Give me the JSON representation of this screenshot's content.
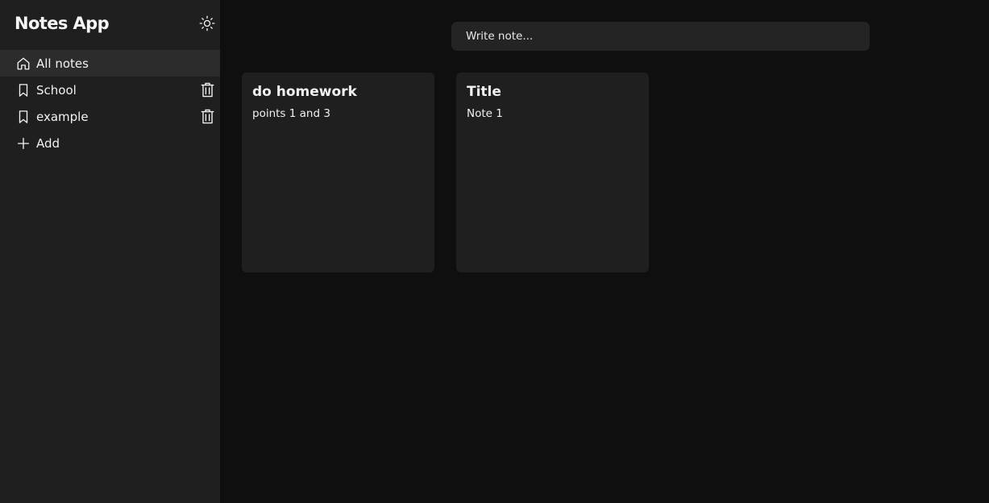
{
  "sidebar": {
    "title": "Notes App",
    "theme_toggle_icon": "sun-icon",
    "items": [
      {
        "label": "All notes",
        "icon": "home-icon",
        "active": true,
        "deletable": false
      },
      {
        "label": "School",
        "icon": "bookmark-icon",
        "active": false,
        "deletable": true
      },
      {
        "label": "example",
        "icon": "bookmark-icon",
        "active": false,
        "deletable": true
      }
    ],
    "add": {
      "label": "Add",
      "icon": "plus-icon"
    }
  },
  "main": {
    "search": {
      "placeholder": "Write note...",
      "value": ""
    },
    "notes": [
      {
        "title": "do homework",
        "body": "points 1 and 3"
      },
      {
        "title": "Title",
        "body": "Note 1"
      }
    ]
  },
  "colors": {
    "background": "#0f0f0f",
    "sidebar": "#1f1f1f",
    "active_item": "#2c2c2c",
    "card": "#1f1f1f",
    "input": "#242424",
    "text": "#f2f2f2"
  }
}
